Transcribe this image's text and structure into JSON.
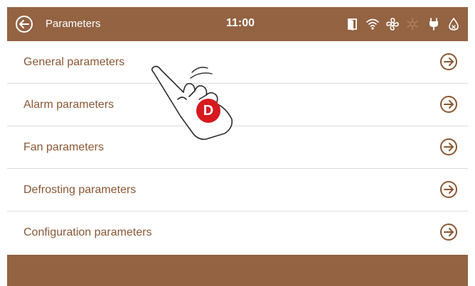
{
  "header": {
    "title": "Parameters",
    "time": "11:00",
    "back_icon": "circle-arrow-left-icon",
    "status_icons": [
      "door-icon",
      "wifi-icon",
      "fan-icon",
      "defrost-icon",
      "plug-icon",
      "water-drop-icon"
    ]
  },
  "menu": {
    "items": [
      {
        "label": "General parameters",
        "icon": "circle-arrow-right-icon"
      },
      {
        "label": "Alarm parameters",
        "icon": "circle-arrow-right-icon"
      },
      {
        "label": "Fan parameters",
        "icon": "circle-arrow-right-icon"
      },
      {
        "label": "Defrosting parameters",
        "icon": "circle-arrow-right-icon"
      },
      {
        "label": "Configuration parameters",
        "icon": "circle-arrow-right-icon"
      }
    ]
  },
  "overlay": {
    "badge_letter": "D",
    "pointer_icon": "hand-pointer-icon"
  },
  "colors": {
    "bar": "#936342",
    "text": "#8a5733",
    "badge": "#d71920",
    "divider": "#dcdcdc"
  }
}
